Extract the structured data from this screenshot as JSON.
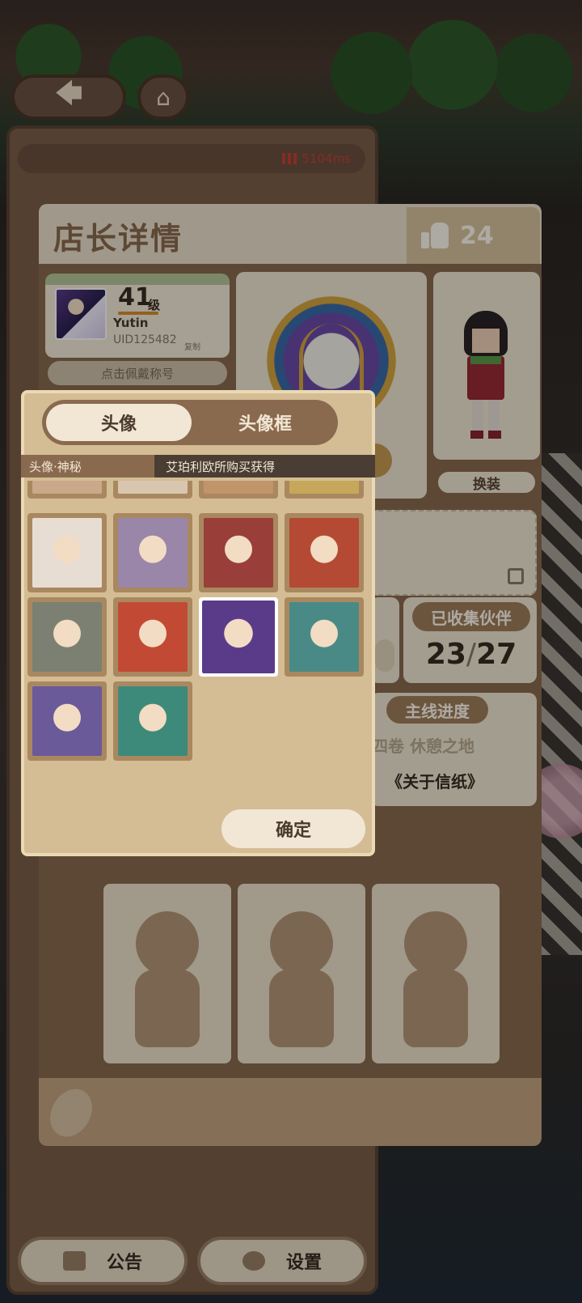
{
  "network": {
    "ping": "5104ms"
  },
  "profile": {
    "title": "店长详情",
    "likes": "24",
    "player": {
      "level": "41",
      "level_unit": "级",
      "name": "Yutin",
      "uid": "UID125482",
      "copy_label": "复制"
    },
    "title_button": "点击佩戴称号",
    "outfit_button": "换装",
    "partners": {
      "label": "已收集伙伴",
      "count": "23",
      "total": "27",
      "slash": "/"
    },
    "story": {
      "label": "主线进度",
      "chapter": "四卷 休憩之地",
      "subtitle": "《关于信纸》"
    }
  },
  "bottom_bar": {
    "announce": "公告",
    "settings": "设置"
  },
  "avatar_modal": {
    "tabs": [
      {
        "label": "头像",
        "active": true
      },
      {
        "label": "头像框",
        "active": false
      }
    ],
    "info": {
      "name": "头像·神秘",
      "source": "艾珀利欧所购买获得"
    },
    "confirm": "确定",
    "avatars": [
      {
        "icon": "avatar-white-hair-icon",
        "color": "#e7ddd2"
      },
      {
        "icon": "avatar-blonde-panda-icon",
        "color": "#9a86a8"
      },
      {
        "icon": "avatar-skull-witch-icon",
        "color": "#9a3e3a"
      },
      {
        "icon": "avatar-horned-red-icon",
        "color": "#b44a34"
      },
      {
        "icon": "avatar-silver-hair-icon",
        "color": "#7b8072"
      },
      {
        "icon": "avatar-star-hat-icon",
        "color": "#c24a34"
      },
      {
        "icon": "avatar-mystery-witch-icon",
        "color": "#5a3b8a",
        "selected": true
      },
      {
        "icon": "avatar-goggles-boy-icon",
        "color": "#4a8a86"
      },
      {
        "icon": "avatar-antler-girl-icon",
        "color": "#6a5a9a"
      },
      {
        "icon": "avatar-teal-girl-icon",
        "color": "#3e8a7a"
      }
    ]
  }
}
